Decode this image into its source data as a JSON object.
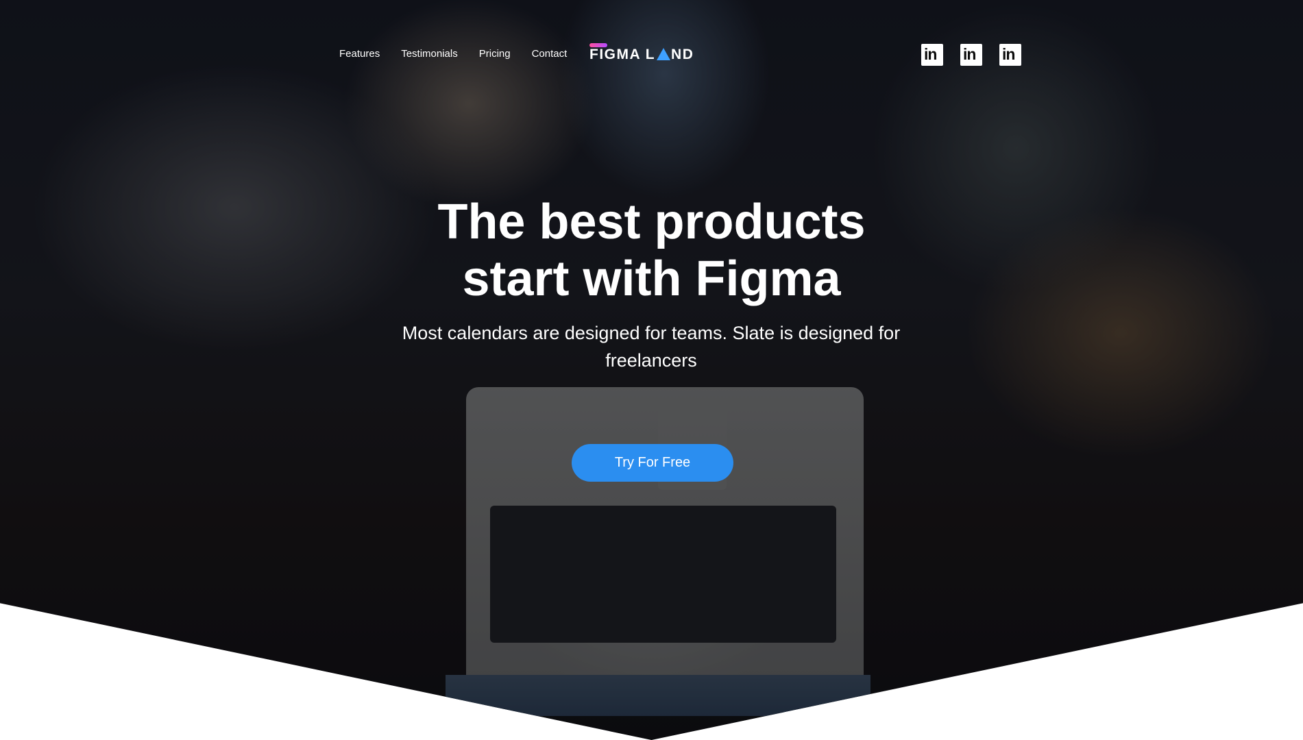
{
  "nav": {
    "items": [
      {
        "label": "Features"
      },
      {
        "label": "Testimonials"
      },
      {
        "label": "Pricing"
      },
      {
        "label": "Contact"
      }
    ]
  },
  "logo": {
    "part1": "FIGMA L",
    "part2": "ND",
    "icon": "triangle-letter-a",
    "accent_colors": [
      "#ff4fa0",
      "#b44cff",
      "#3ea0ff"
    ]
  },
  "social": {
    "icons": [
      "linkedin-icon",
      "linkedin-icon",
      "linkedin-icon"
    ],
    "glyph": "in"
  },
  "hero": {
    "title_line1": "The best products",
    "title_line2": "start with Figma",
    "subtitle": "Most calendars are designed for teams. Slate is designed for freelancers",
    "cta_label": "Try For Free",
    "cta_color": "#2b8ef0"
  }
}
